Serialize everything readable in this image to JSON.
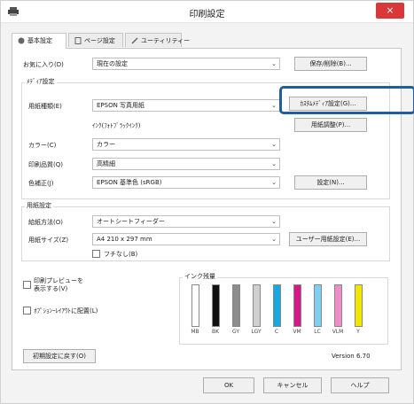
{
  "window": {
    "title": "印刷設定",
    "close_glyph": "×"
  },
  "tabs": [
    {
      "label": "基本設定",
      "icon": "printer-tab-icon"
    },
    {
      "label": "ページ設定",
      "icon": "page-tab-icon"
    },
    {
      "label": "ユーティリティー",
      "icon": "utility-tab-icon"
    }
  ],
  "favorites": {
    "label": "お気に入り(D)",
    "value": "現在の設定",
    "save_button": "保存/削除(B)..."
  },
  "media": {
    "group_label": "ﾒﾃﾞｨｱ設定",
    "type_label": "用紙種類(E)",
    "type_value": "EPSON 写真用紙",
    "custom_media_button": "ｶｽﾀﾑﾒﾃﾞｨｱ設定(G)...",
    "ink_label": "ｲﾝｸ(ﾌｫﾄﾌﾞﾗｯｸｲﾝｸ)",
    "paper_adjust_button": "用紙調整(P)...",
    "color_label": "カラー(C)",
    "color_value": "カラー",
    "quality_label": "印刷品質(Q)",
    "quality_value": "高精細",
    "mode_label": "色補正(J)",
    "mode_value": "EPSON 基準色 (sRGB)",
    "settings_button": "設定(N)..."
  },
  "paper": {
    "group_label": "用紙設定",
    "source_label": "給紙方法(O)",
    "source_value": "オートシートフィーダー",
    "size_label": "用紙サイズ(Z)",
    "size_value": "A4 210 x 297 mm",
    "user_size_button": "ユーザー用紙設定(E)...",
    "borderless_label": "フチなし(B)"
  },
  "options": {
    "preview_label": "印刷プレビューを表示する(V)",
    "layout_label": "ｵﾌﾟｼｮﾝｰﾚｲｱｳﾄに配置(L)"
  },
  "ink_levels": {
    "label": "インク残量",
    "inks": [
      {
        "name": "MB",
        "color": "#ffffff",
        "level": 0.95
      },
      {
        "name": "BK",
        "color": "#111111",
        "level": 0.95
      },
      {
        "name": "GY",
        "color": "#8c8c8c",
        "level": 0.95
      },
      {
        "name": "LGY",
        "color": "#cfcfcf",
        "level": 0.95
      },
      {
        "name": "C",
        "color": "#18a8e0",
        "level": 0.95
      },
      {
        "name": "VM",
        "color": "#d4188a",
        "level": 0.95
      },
      {
        "name": "LC",
        "color": "#7fd0f0",
        "level": 0.95
      },
      {
        "name": "VLM",
        "color": "#f08cc8",
        "level": 0.95
      },
      {
        "name": "Y",
        "color": "#f2e600",
        "level": 0.95
      }
    ]
  },
  "restore_button": "初期設定に戻す(O)",
  "version": "Version 6.70",
  "footer": {
    "ok": "OK",
    "cancel": "キャンセル",
    "help": "ヘルプ"
  },
  "colors": {
    "highlight_box": "#1f5fa0",
    "close_button": "#d9383a"
  }
}
